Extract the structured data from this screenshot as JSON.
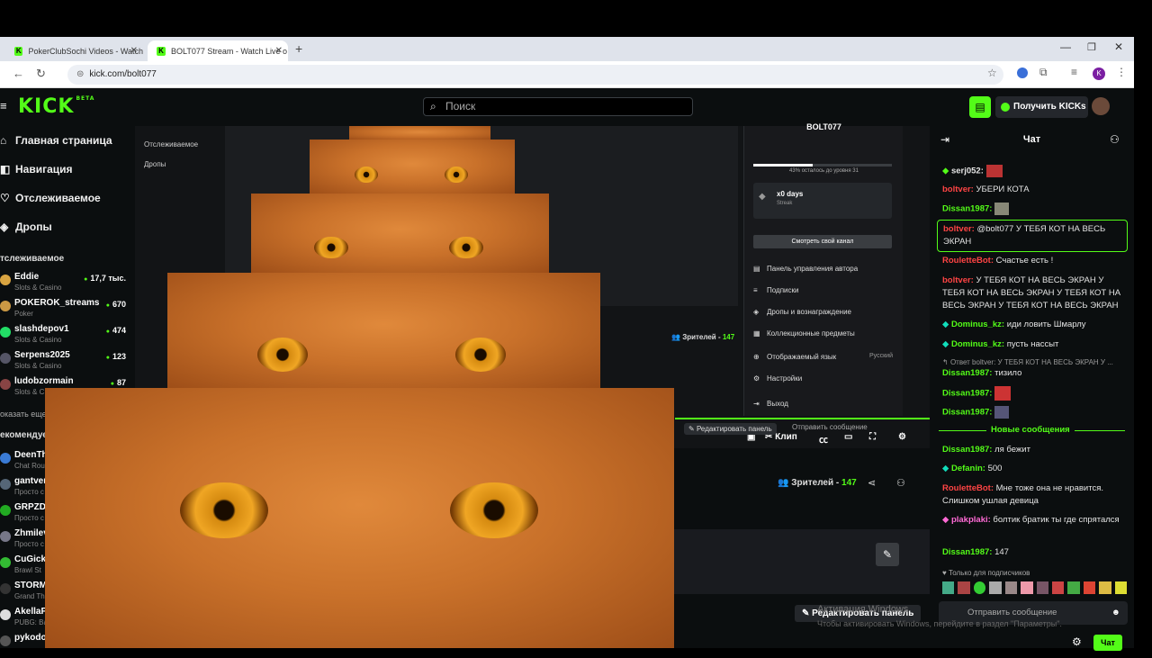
{
  "browser": {
    "tabs": [
      {
        "title": "PokerClubSochi Videos - Watch",
        "active": false
      },
      {
        "title": "BOLT077 Stream - Watch Live o",
        "active": true
      }
    ],
    "url": "kick.com/bolt077",
    "profile_initial": "K"
  },
  "header": {
    "logo": "KICK",
    "logo_badge": "BETA",
    "search_placeholder": "Поиск",
    "get_kicks_label": "Получить KICKs"
  },
  "sidebar": {
    "nav": [
      "Главная страница",
      "Навигация",
      "Отслеживаемое",
      "Дропы"
    ],
    "followed_heading": "тслеживаемое",
    "followed": [
      {
        "name": "Eddie",
        "category": "Slots & Casino",
        "viewers": "17,7 тыс."
      },
      {
        "name": "POKEROK_streams",
        "category": "Poker",
        "viewers": "670"
      },
      {
        "name": "slashdepov1",
        "category": "Slots & Casino",
        "viewers": "474"
      },
      {
        "name": "Serpens2025",
        "category": "Slots & Casino",
        "viewers": "123"
      },
      {
        "name": "ludobzormain",
        "category": "Slots & C",
        "viewers": "87"
      }
    ],
    "show_more": "оказать еще",
    "recommended_heading": "екомендуе",
    "recommended": [
      {
        "name": "DeenTh",
        "category": "Chat Rou"
      },
      {
        "name": "gantver",
        "category": "Просто с"
      },
      {
        "name": "GRPZD(",
        "category": "Просто с"
      },
      {
        "name": "Zhmilev",
        "category": "Просто с"
      },
      {
        "name": "CuGickl",
        "category": "Brawl St"
      },
      {
        "name": "STORM",
        "category": "Grand Th"
      },
      {
        "name": "AkellaP",
        "category": "PUBG: Ba"
      },
      {
        "name": "pykodo",
        "category": ""
      }
    ]
  },
  "player": {
    "menu_title": "BOLT077",
    "streak": "x0 days",
    "streak_sub": "Streak",
    "progress_text": "43% осталось до уровня 31",
    "progress_pct": 43,
    "watch_channel": "Смотреть свой канал",
    "menu_items": [
      "Панель управления автора",
      "Подписки",
      "Дропы и вознаграждение",
      "Коллекционные предметы",
      "Отображаемый язык",
      "Настройки",
      "Выход"
    ],
    "language_value": "Русский",
    "clip_label": "Клип",
    "edit_panel": "Редактировать панель",
    "send_message": "Отправить сообщение",
    "viewers_label": "Зрителей -",
    "viewers_count": "147"
  },
  "below_player": {
    "viewers_label": "Зрителей -",
    "viewers_count": "147",
    "edit_panel": "Редактировать панель"
  },
  "chat": {
    "title": "Чат",
    "messages": [
      {
        "user": "serj052:",
        "text": "",
        "color": "#ffffff"
      },
      {
        "user": "boltver:",
        "text": " УБЕРИ КОТА",
        "color": "#ff4444"
      },
      {
        "user": "Dissan1987:",
        "text": "",
        "color": "#53fc18"
      },
      {
        "user": "boltver:",
        "text": " @bolt077 У ТЕБЯ КОТ НА ВЕСЬ ЭКРАН",
        "color": "#ff4444"
      },
      {
        "user": "RouletteBot:",
        "text": " Счастье есть !",
        "color": "#ff4444"
      },
      {
        "user": "boltver:",
        "text": " У ТЕБЯ КОТ НА ВЕСЬ ЭКРАН У ТЕБЯ КОТ НА ВЕСЬ ЭКРАН У ТЕБЯ КОТ НА ВЕСЬ ЭКРАН У ТЕБЯ КОТ НА ВЕСЬ ЭКРАН",
        "color": "#ff4444"
      },
      {
        "user": "Dominus_kz:",
        "text": " иди ловить Шмарлу",
        "color": "#53fc18"
      },
      {
        "user": "Dominus_kz:",
        "text": " пусть нассыт",
        "color": "#53fc18"
      }
    ],
    "reply_note": "Ответ boltver: У ТЕБЯ КОТ НА ВЕСЬ ЭКРАН У ...",
    "messages2": [
      {
        "user": "Dissan1987:",
        "text": " тизило",
        "color": "#53fc18"
      },
      {
        "user": "Dissan1987:",
        "text": "",
        "color": "#53fc18"
      },
      {
        "user": "Dissan1987:",
        "text": "",
        "color": "#53fc18"
      }
    ],
    "new_messages": "Новые сообщения",
    "messages3": [
      {
        "user": "Dissan1987:",
        "text": " ля бежит",
        "color": "#53fc18"
      },
      {
        "user": "Defanin:",
        "text": " 500",
        "color": "#53fc18"
      },
      {
        "user": "RouletteBot:",
        "text": " Мне тоже она не нравится. Слишком ушлая девица",
        "color": "#ff4444"
      },
      {
        "user": "plakplaki:",
        "text": " болтик братик ты где спрятался",
        "color": "#ff6ad5"
      },
      {
        "user": "Dissan1987:",
        "text": " 147",
        "color": "#53fc18"
      }
    ],
    "subs_only": "Только для подписчиков",
    "input_placeholder": "Отправить сообщение",
    "send_button": "Чат"
  },
  "watermark": {
    "line1": "Активация Windows",
    "line2": "Чтобы активировать Windows, перейдите в раздел \"Параметры\"."
  },
  "colors": {
    "accent": "#53fc18",
    "background": "#0b0e0f"
  }
}
